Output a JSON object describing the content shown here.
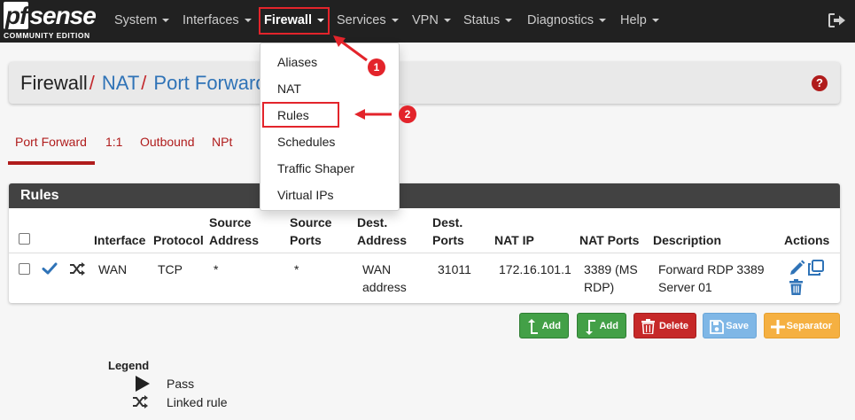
{
  "brand": {
    "logo_pf": "pf",
    "logo_sense": "sense",
    "logo_sub": "COMMUNITY EDITION"
  },
  "nav": {
    "system": "System",
    "interfaces": "Interfaces",
    "firewall": "Firewall",
    "services": "Services",
    "vpn": "VPN",
    "status": "Status",
    "diagnostics": "Diagnostics",
    "help": "Help"
  },
  "breadcrumb": {
    "part1": "Firewall",
    "sep1": "/",
    "part2": "NAT",
    "sep2": "/",
    "part3": "Port Forward"
  },
  "tabs": {
    "port_forward": "Port Forward",
    "one_to_one": "1:1",
    "outbound": "Outbound",
    "npt": "NPt"
  },
  "rules": {
    "title": "Rules",
    "headers": {
      "interface": "Interface",
      "protocol": "Protocol",
      "source_address": [
        "Source",
        "Address"
      ],
      "source_ports": [
        "Source",
        "Ports"
      ],
      "dest_address": [
        "Dest.",
        "Address"
      ],
      "dest_ports": [
        "Dest.",
        "Ports"
      ],
      "nat_ip": "NAT IP",
      "nat_ports": "NAT Ports",
      "description": "Description",
      "actions": "Actions"
    },
    "row": {
      "interface": "WAN",
      "protocol": "TCP",
      "source_address": "*",
      "source_ports": "*",
      "dest_address": [
        "WAN",
        "address"
      ],
      "dest_ports": "31011",
      "nat_ip": "172.16.101.1",
      "nat_ports": [
        "3389 (MS",
        "RDP)"
      ],
      "description": [
        "Forward RDP 3389",
        "Server 01"
      ]
    }
  },
  "buttons": {
    "add_top": "Add",
    "add_bottom": "Add",
    "delete": "Delete",
    "save": "Save",
    "separator": "Separator"
  },
  "legend": {
    "title": "Legend",
    "pass": "Pass",
    "linked": "Linked rule"
  },
  "firewall_menu": {
    "items": [
      "Aliases",
      "NAT",
      "Rules",
      "Schedules",
      "Traffic Shaper",
      "Virtual IPs"
    ]
  },
  "annotations": {
    "step1": "1",
    "step2": "2"
  },
  "colors": {
    "brand_red": "#b01c1c",
    "link_blue": "#2f73b7",
    "annotation_red": "#e3242b",
    "add_green": "#43a047",
    "save_blue": "#7fb7e6",
    "separator_orange": "#f5b041"
  }
}
